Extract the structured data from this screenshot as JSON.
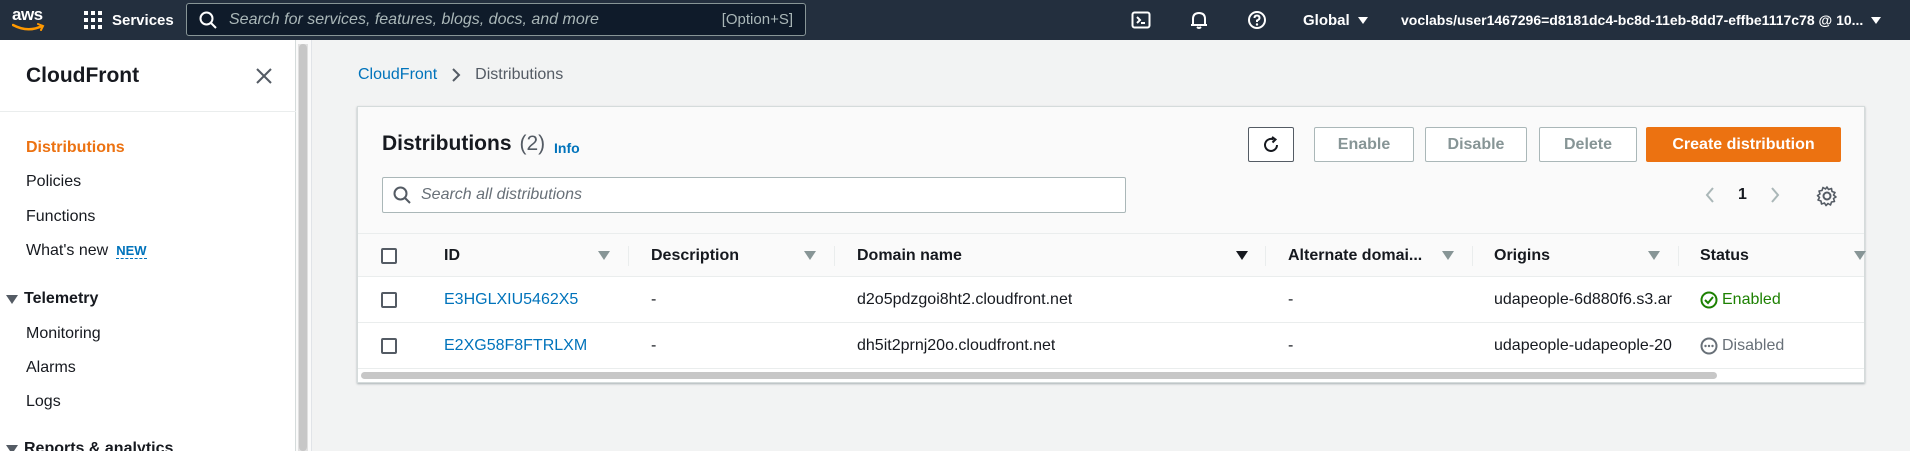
{
  "topnav": {
    "logo_text": "aws",
    "services_label": "Services",
    "search_placeholder": "Search for services, features, blogs, docs, and more",
    "search_shortcut": "[Option+S]",
    "region": "Global",
    "account": "voclabs/user1467296=d8181dc4-bc8d-11eb-8dd7-effbe1117c78 @ 10..."
  },
  "sidebar": {
    "title": "CloudFront",
    "items": [
      {
        "label": "Distributions",
        "active": true
      },
      {
        "label": "Policies"
      },
      {
        "label": "Functions"
      },
      {
        "label": "What's new",
        "badge": "NEW"
      }
    ],
    "sections": [
      {
        "label": "Telemetry",
        "items": [
          "Monitoring",
          "Alarms",
          "Logs"
        ]
      },
      {
        "label": "Reports & analytics"
      }
    ]
  },
  "breadcrumb": {
    "root": "CloudFront",
    "current": "Distributions"
  },
  "panel": {
    "title": "Distributions",
    "count": "(2)",
    "info": "Info",
    "buttons": {
      "enable": "Enable",
      "disable": "Disable",
      "delete": "Delete",
      "create": "Create distribution"
    },
    "search_placeholder": "Search all distributions",
    "page": "1"
  },
  "table": {
    "columns": [
      "ID",
      "Description",
      "Domain name",
      "Alternate domai...",
      "Origins",
      "Status"
    ],
    "rows": [
      {
        "id": "E3HGLXIU5462X5",
        "description": "-",
        "domain": "d2o5pdzgoi8ht2.cloudfront.net",
        "alt": "-",
        "origins": "udapeople-6d880f6.s3.ar",
        "status": "Enabled"
      },
      {
        "id": "E2XG58F8FTRLXM",
        "description": "-",
        "domain": "dh5it2prnj20o.cloudfront.net",
        "alt": "-",
        "origins": "udapeople-udapeople-20",
        "status": "Disabled"
      }
    ]
  },
  "colors": {
    "nav_bg": "#232f3e",
    "accent": "#ec7211",
    "link": "#0073bb",
    "enabled": "#1d8102"
  }
}
